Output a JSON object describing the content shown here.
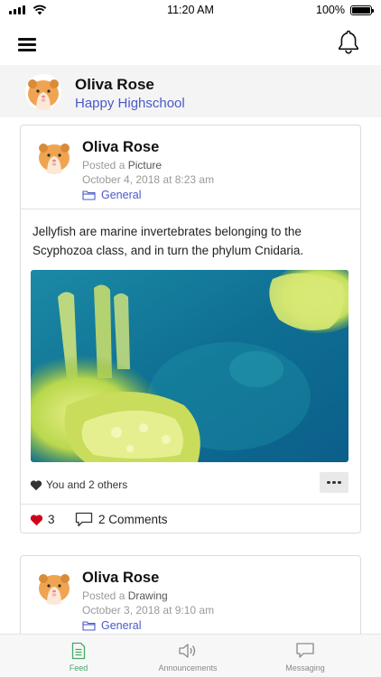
{
  "status_bar": {
    "time": "11:20 AM",
    "battery": "100%",
    "battery_level": 1.0,
    "signal_icon": "signal-bars-icon",
    "wifi_icon": "wifi-icon"
  },
  "nav": {
    "menu_icon": "hamburger-menu-icon",
    "bell_icon": "bell-icon"
  },
  "profile": {
    "name": "Oliva Rose",
    "school": "Happy Highschool"
  },
  "posts": [
    {
      "author": "Oliva Rose",
      "posted_prefix": "Posted a ",
      "post_type": "Picture",
      "date": "October 4, 2018 at 8:23 am",
      "category": "General",
      "text": "Jellyfish are marine invertebrates belonging to the Scyphozoa class, and in turn the phylum Cnidaria.",
      "likes_text": "You and 2 others",
      "like_count": "3",
      "comments": "2 Comments"
    },
    {
      "author": "Oliva Rose",
      "posted_prefix": "Posted a ",
      "post_type": "Drawing",
      "date": "October 3, 2018 at 9:10 am",
      "category": "General"
    }
  ],
  "tabs": [
    {
      "label": "Feed",
      "icon": "document-icon",
      "active": true
    },
    {
      "label": "Announcements",
      "icon": "speaker-icon",
      "active": false
    },
    {
      "label": "Messaging",
      "icon": "chat-bubble-icon",
      "active": false
    }
  ],
  "colors": {
    "accent_blue": "#4a59c9",
    "active_tab_green": "#47a86a",
    "heart_red": "#d0021b",
    "header_bg": "#f4f4f4"
  }
}
